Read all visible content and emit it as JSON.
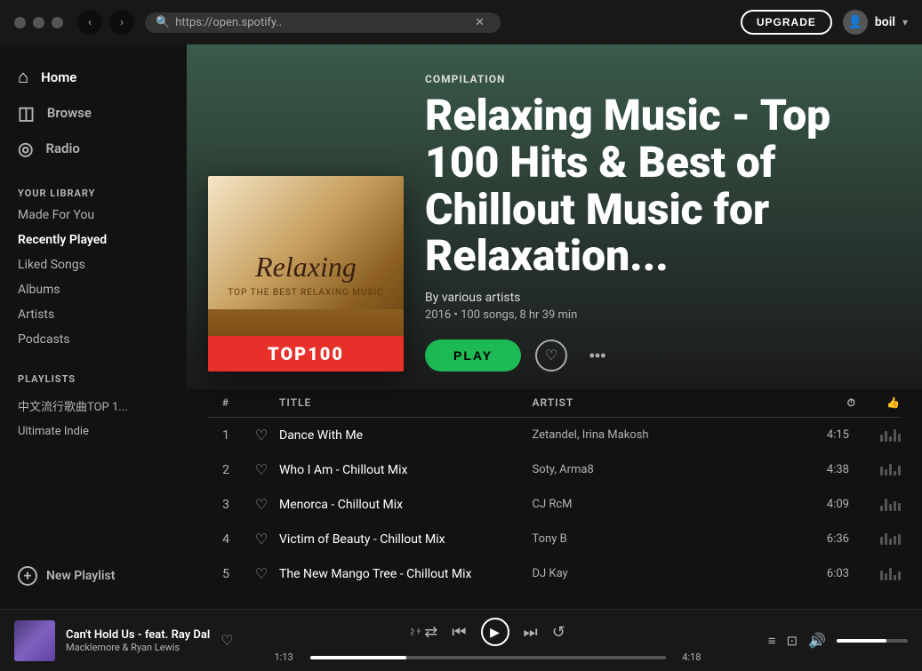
{
  "topbar": {
    "url": "https://open.spotify..",
    "url_full": "https://open.spotify.",
    "upgrade_label": "UPGRADE",
    "username": "boil",
    "chevron": "▾"
  },
  "sidebar": {
    "nav": [
      {
        "id": "home",
        "label": "Home",
        "icon": "⌂"
      },
      {
        "id": "browse",
        "label": "Browse",
        "icon": "◫"
      },
      {
        "id": "radio",
        "label": "Radio",
        "icon": "◎"
      }
    ],
    "library_section": "YOUR LIBRARY",
    "library_items": [
      {
        "id": "made-for-you",
        "label": "Made For You"
      },
      {
        "id": "recently-played",
        "label": "Recently Played"
      },
      {
        "id": "liked-songs",
        "label": "Liked Songs"
      },
      {
        "id": "albums",
        "label": "Albums"
      },
      {
        "id": "artists",
        "label": "Artists"
      },
      {
        "id": "podcasts",
        "label": "Podcasts"
      }
    ],
    "playlists_section": "PLAYLISTS",
    "playlists": [
      {
        "id": "chinese-top",
        "label": "中文流行歌曲TOP 1..."
      },
      {
        "id": "ultimate-indie",
        "label": "Ultimate Indie"
      }
    ],
    "new_playlist_label": "New Playlist"
  },
  "album": {
    "type_label": "COMPILATION",
    "title": "Relaxing Music - Top 100 Hits & Best of Chillout Music for Relaxation...",
    "by_label": "By various artists",
    "year": "2016",
    "song_count": "100 songs",
    "duration": "8 hr 39 min",
    "art_title": "Relaxing",
    "art_subtitle": "TOP THE BEST RELAXING MUSIC",
    "art_badge": "TOP100",
    "play_label": "PLAY"
  },
  "tracklist": {
    "headers": {
      "num": "#",
      "heart": "",
      "title": "TITLE",
      "artist": "ARTIST",
      "duration": "⏱",
      "popularity": "👍"
    },
    "tracks": [
      {
        "num": "1",
        "title": "Dance With Me",
        "artist": "Zetandel, Irina Makosh",
        "duration": "4:15"
      },
      {
        "num": "2",
        "title": "Who I Am - Chillout Mix",
        "artist": "Soty, Arma8",
        "duration": "4:38"
      },
      {
        "num": "3",
        "title": "Menorca - Chillout Mix",
        "artist": "CJ RcM",
        "duration": "4:09"
      },
      {
        "num": "4",
        "title": "Victim of Beauty - Chillout Mix",
        "artist": "Tony B",
        "duration": "6:36"
      },
      {
        "num": "5",
        "title": "The New Mango Tree - Chillout Mix",
        "artist": "DJ Kay",
        "duration": "6:03"
      }
    ]
  },
  "player": {
    "track_name": "Can't Hold Us - feat. Ray Dal",
    "artist_name": "Macklemore & Ryan Lewis",
    "current_time": "1:13",
    "total_time": "4:18",
    "progress_pct": 27
  }
}
